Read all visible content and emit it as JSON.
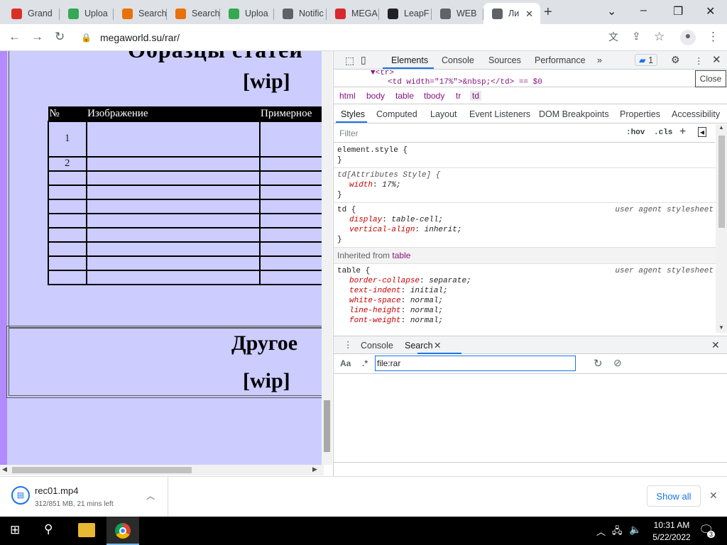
{
  "tabs": [
    {
      "label": "Grand",
      "icon": "document-icon",
      "color": "#d93025"
    },
    {
      "label": "Uploa",
      "icon": "upload-icon",
      "color": "#34a853"
    },
    {
      "label": "Search",
      "icon": "search-person-icon",
      "color": "#e8710a"
    },
    {
      "label": "Search",
      "icon": "search-person-icon",
      "color": "#e8710a"
    },
    {
      "label": "Uploa",
      "icon": "upload-icon",
      "color": "#34a853"
    },
    {
      "label": "Notific",
      "icon": "globe-icon",
      "color": "#5f6368"
    },
    {
      "label": "MEGA",
      "icon": "mega-icon",
      "color": "#d9272e"
    },
    {
      "label": "LeapF",
      "icon": "leap-icon",
      "color": "#202124"
    },
    {
      "label": "WEB",
      "icon": "eye-icon",
      "color": "#5f6368"
    },
    {
      "label": "Ли",
      "icon": "globe-icon",
      "color": "#5f6368",
      "active": true
    }
  ],
  "address": {
    "url": "megaworld.su/rar/"
  },
  "page": {
    "wip1": "[wip]",
    "table_headers": [
      "№",
      "Изображение",
      "Примерное"
    ],
    "rows": [
      "1",
      "2",
      "",
      "",
      "",
      "",
      "",
      "",
      "",
      ""
    ],
    "other": "Другое",
    "wip2": "[wip]"
  },
  "devtools": {
    "tabs": [
      "Elements",
      "Console",
      "Sources",
      "Performance"
    ],
    "issues_count": "1",
    "dom_line1": "▼<tr>",
    "dom_line2": "<td width=\"17%\">&nbsp;</td> == $0",
    "breadcrumbs": [
      "html",
      "body",
      "table",
      "tbody",
      "tr",
      "td"
    ],
    "subtabs": [
      "Styles",
      "Computed",
      "Layout",
      "Event Listeners",
      "DOM Breakpoints",
      "Properties",
      "Accessibility"
    ],
    "filter_placeholder": "Filter",
    "hov": ":hov",
    "cls": ".cls",
    "rules": {
      "element_style": "element.style {",
      "td_attr": "td[Attributes Style] {",
      "td_attr_prop": "width",
      "td_attr_val": "17%;",
      "td_sel": "td {",
      "td_ua": "user agent stylesheet",
      "td_p1": "display",
      "td_v1": "table-cell;",
      "td_p2": "vertical-align",
      "td_v2": "inherit;",
      "inherited_label": "Inherited from",
      "inherited_from": "table",
      "table_sel": "table {",
      "table_ua": "user agent stylesheet",
      "table_props": [
        {
          "p": "border-collapse",
          "v": "separate;"
        },
        {
          "p": "text-indent",
          "v": "initial;"
        },
        {
          "p": "white-space",
          "v": "normal;"
        },
        {
          "p": "line-height",
          "v": "normal;"
        },
        {
          "p": "font-weight",
          "v": "normal;"
        }
      ]
    },
    "drawer_tabs": [
      "Console",
      "Search"
    ],
    "search_value": "file:rar",
    "search_aa": "Aa",
    "search_regex": ".*",
    "tooltip": "Close"
  },
  "downloads": {
    "filename": "rec01.mp4",
    "status": "312/851 MB, 21 mins left",
    "show_all": "Show all"
  },
  "taskbar": {
    "time": "10:31 AM",
    "date": "5/22/2022",
    "notif_count": "3"
  }
}
